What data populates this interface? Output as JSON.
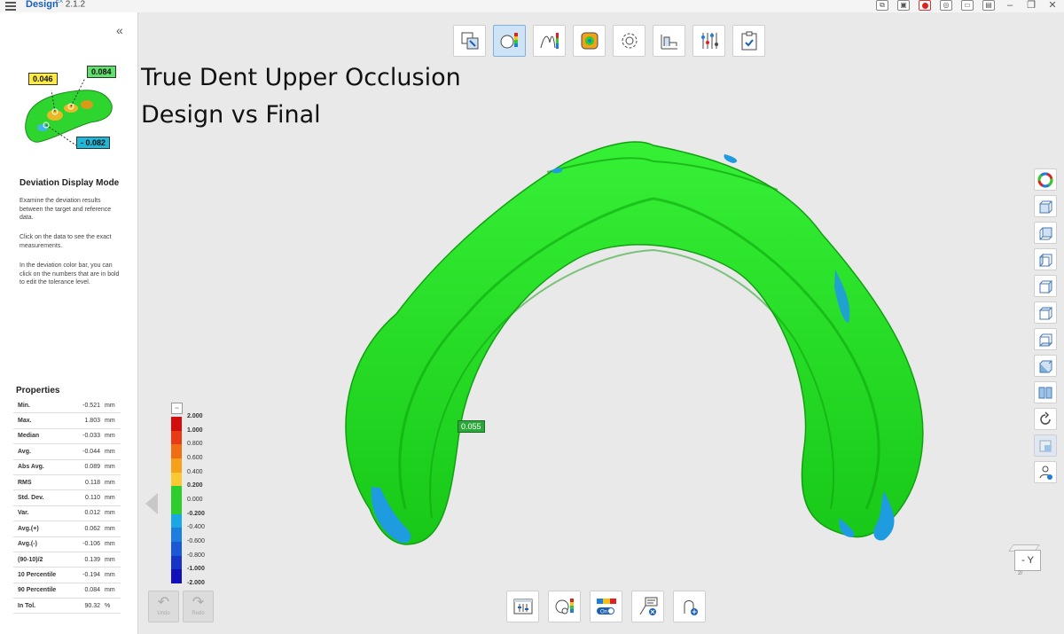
{
  "titlebar": {
    "app_name": "Design",
    "version_prefix": "EX",
    "version": "2.1.2"
  },
  "left_panel": {
    "collapse_glyph": "«",
    "thumb_tags": {
      "yellow": "0.046",
      "green": "0.084",
      "cyan": "- 0.082"
    },
    "help_title": "Deviation Display Mode",
    "help_p1": "Examine the deviation results between the target and reference data.",
    "help_p2": "Click on the data to see the exact measurements.",
    "help_p3": "In the deviation color bar, you can click on the numbers that are in bold to edit the tolerance level.",
    "properties_title": "Properties",
    "properties": [
      {
        "name": "Min.",
        "value": "-0.521",
        "unit": "mm"
      },
      {
        "name": "Max.",
        "value": "1.803",
        "unit": "mm"
      },
      {
        "name": "Median",
        "value": "-0.033",
        "unit": "mm"
      },
      {
        "name": "Avg.",
        "value": "-0.044",
        "unit": "mm"
      },
      {
        "name": "Abs Avg.",
        "value": "0.089",
        "unit": "mm"
      },
      {
        "name": "RMS",
        "value": "0.118",
        "unit": "mm"
      },
      {
        "name": "Std. Dev.",
        "value": "0.110",
        "unit": "mm"
      },
      {
        "name": "Var.",
        "value": "0.012",
        "unit": "mm"
      },
      {
        "name": "Avg.(+)",
        "value": "0.062",
        "unit": "mm"
      },
      {
        "name": "Avg.(-)",
        "value": "-0.106",
        "unit": "mm"
      },
      {
        "name": "(90-10)/2",
        "value": "0.139",
        "unit": "mm"
      },
      {
        "name": "10 Percentile",
        "value": "-0.194",
        "unit": "mm"
      },
      {
        "name": "90 Percentile",
        "value": "0.084",
        "unit": "mm"
      },
      {
        "name": "In Tol.",
        "value": "90.32",
        "unit": "%"
      }
    ]
  },
  "viewport": {
    "overlay_title_1": "True Dent Upper Occlusion",
    "overlay_title_2": "Design vs Final",
    "measurement_label": "0.055",
    "orientation_label": "- Y",
    "orientation_small": "2r"
  },
  "color_bar": {
    "labels": [
      "2.000",
      "1.000",
      "0.800",
      "0.600",
      "0.400",
      "0.200",
      "0.000",
      "-0.200",
      "-0.400",
      "-0.600",
      "-0.800",
      "-1.000",
      "-2.000"
    ],
    "bold_labels": [
      "2.000",
      "1.000",
      "0.200",
      "-0.200",
      "-1.000",
      "-2.000"
    ],
    "colors": [
      "#d10d0d",
      "#e83a14",
      "#f06d12",
      "#f7a11a",
      "#f9c832",
      "#2ccd2c",
      "#2ccd2c",
      "#19a7e6",
      "#1c7fe0",
      "#1b58d6",
      "#1734c9",
      "#1210b8"
    ]
  },
  "undo_redo": {
    "undo": "Undo",
    "redo": "Redo"
  },
  "colors": {
    "model_green": "#1fe01f",
    "model_blue": "#1f9be0",
    "accent": "#1a5fb4"
  }
}
